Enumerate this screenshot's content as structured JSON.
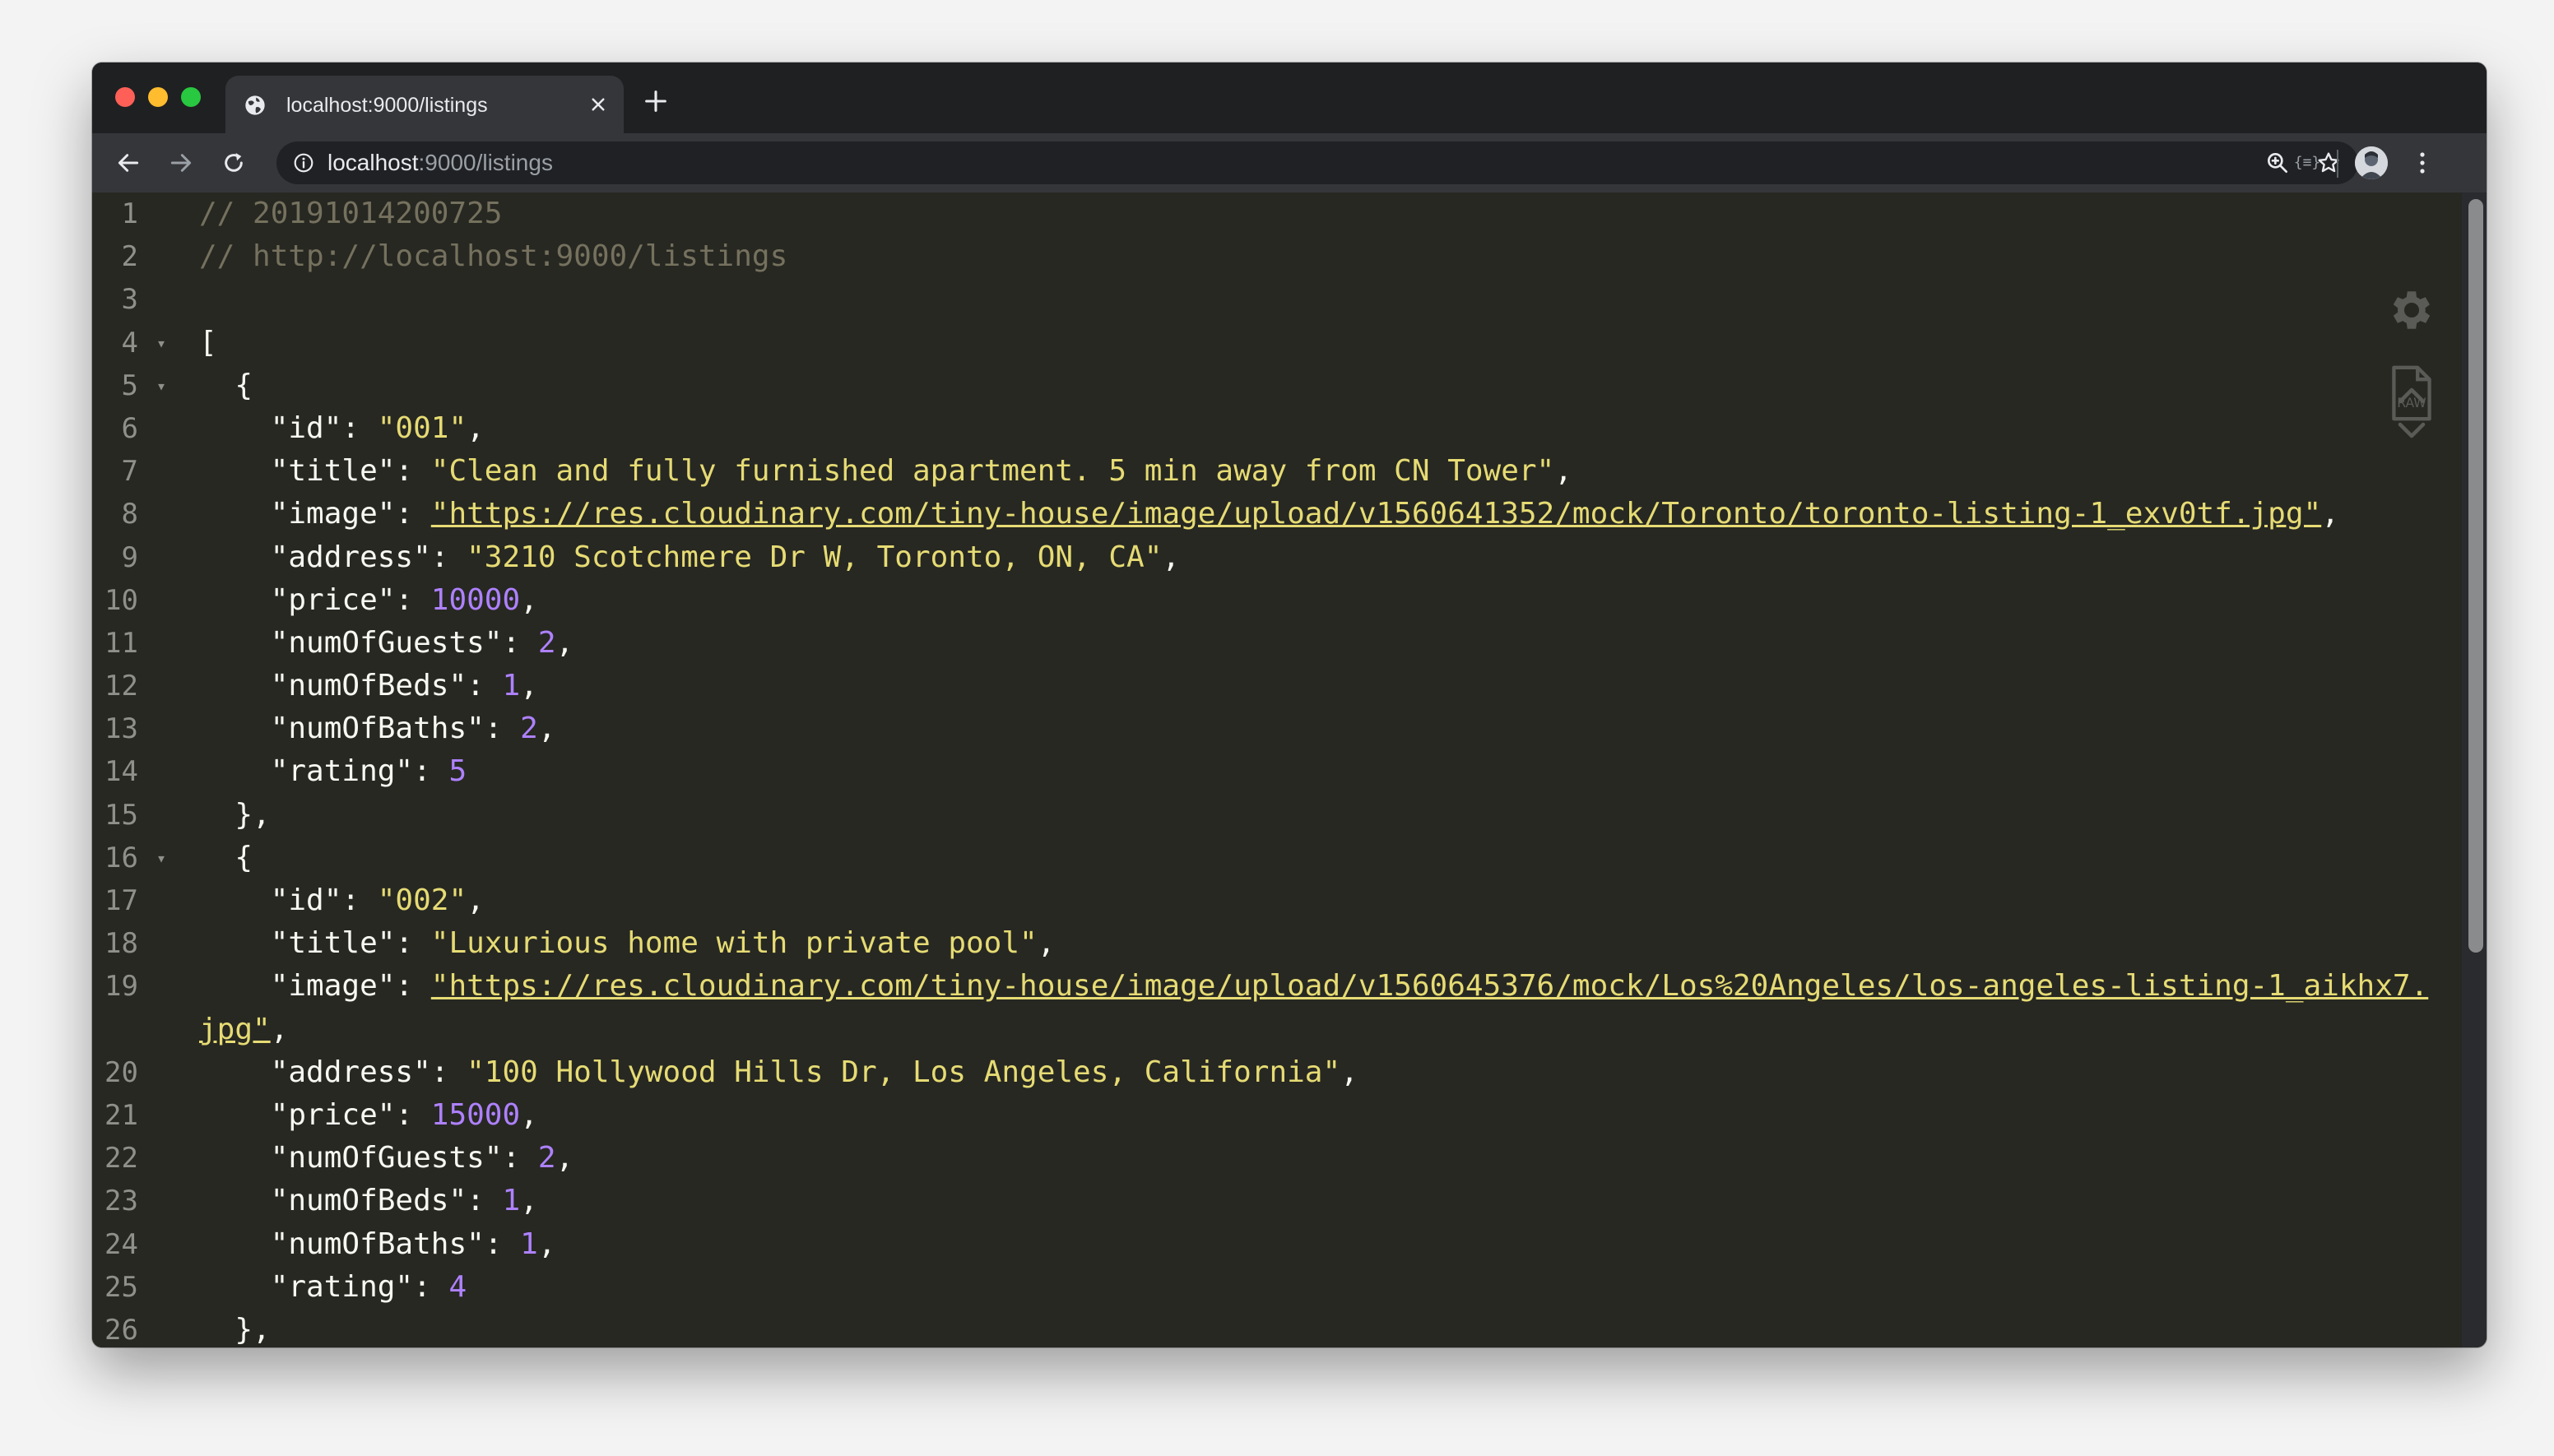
{
  "tab": {
    "title": "localhost:9000/listings"
  },
  "omnibox": {
    "host": "localhost",
    "path": ":9000/listings"
  },
  "extension_label": "{≡}",
  "viewer": {
    "raw_label": "RAW"
  },
  "lines": [
    {
      "n": "1",
      "fold": "",
      "segs": [
        {
          "c": "cm",
          "t": "// 20191014200725"
        }
      ]
    },
    {
      "n": "2",
      "fold": "",
      "segs": [
        {
          "c": "cm",
          "t": "// http://localhost:9000/listings"
        }
      ]
    },
    {
      "n": "3",
      "fold": "",
      "segs": []
    },
    {
      "n": "4",
      "fold": "▾",
      "segs": [
        {
          "c": "key",
          "t": "["
        }
      ]
    },
    {
      "n": "5",
      "fold": "▾",
      "segs": [
        {
          "c": "key",
          "t": "  {"
        }
      ]
    },
    {
      "n": "6",
      "fold": "",
      "segs": [
        {
          "c": "key",
          "t": "    \"id\": "
        },
        {
          "c": "str",
          "t": "\"001\""
        },
        {
          "c": "key",
          "t": ","
        }
      ]
    },
    {
      "n": "7",
      "fold": "",
      "segs": [
        {
          "c": "key",
          "t": "    \"title\": "
        },
        {
          "c": "str",
          "t": "\"Clean and fully furnished apartment. 5 min away from CN Tower\""
        },
        {
          "c": "key",
          "t": ","
        }
      ]
    },
    {
      "n": "8",
      "fold": "",
      "segs": [
        {
          "c": "key",
          "t": "    \"image\": "
        },
        {
          "c": "url",
          "t": "\"https://res.cloudinary.com/tiny-house/image/upload/v1560641352/mock/Toronto/toronto-listing-1_exv0tf.jpg\""
        },
        {
          "c": "key",
          "t": ","
        }
      ]
    },
    {
      "n": "9",
      "fold": "",
      "segs": [
        {
          "c": "key",
          "t": "    \"address\": "
        },
        {
          "c": "str",
          "t": "\"3210 Scotchmere Dr W, Toronto, ON, CA\""
        },
        {
          "c": "key",
          "t": ","
        }
      ]
    },
    {
      "n": "10",
      "fold": "",
      "segs": [
        {
          "c": "key",
          "t": "    \"price\": "
        },
        {
          "c": "num",
          "t": "10000"
        },
        {
          "c": "key",
          "t": ","
        }
      ]
    },
    {
      "n": "11",
      "fold": "",
      "segs": [
        {
          "c": "key",
          "t": "    \"numOfGuests\": "
        },
        {
          "c": "num",
          "t": "2"
        },
        {
          "c": "key",
          "t": ","
        }
      ]
    },
    {
      "n": "12",
      "fold": "",
      "segs": [
        {
          "c": "key",
          "t": "    \"numOfBeds\": "
        },
        {
          "c": "num",
          "t": "1"
        },
        {
          "c": "key",
          "t": ","
        }
      ]
    },
    {
      "n": "13",
      "fold": "",
      "segs": [
        {
          "c": "key",
          "t": "    \"numOfBaths\": "
        },
        {
          "c": "num",
          "t": "2"
        },
        {
          "c": "key",
          "t": ","
        }
      ]
    },
    {
      "n": "14",
      "fold": "",
      "segs": [
        {
          "c": "key",
          "t": "    \"rating\": "
        },
        {
          "c": "num",
          "t": "5"
        }
      ]
    },
    {
      "n": "15",
      "fold": "",
      "segs": [
        {
          "c": "key",
          "t": "  },"
        }
      ]
    },
    {
      "n": "16",
      "fold": "▾",
      "segs": [
        {
          "c": "key",
          "t": "  {"
        }
      ]
    },
    {
      "n": "17",
      "fold": "",
      "segs": [
        {
          "c": "key",
          "t": "    \"id\": "
        },
        {
          "c": "str",
          "t": "\"002\""
        },
        {
          "c": "key",
          "t": ","
        }
      ]
    },
    {
      "n": "18",
      "fold": "",
      "segs": [
        {
          "c": "key",
          "t": "    \"title\": "
        },
        {
          "c": "str",
          "t": "\"Luxurious home with private pool\""
        },
        {
          "c": "key",
          "t": ","
        }
      ]
    },
    {
      "n": "19",
      "fold": "",
      "tall": true,
      "segs": [
        {
          "c": "key",
          "t": "    \"image\": "
        },
        {
          "c": "url",
          "t": "\"https://res.cloudinary.com/tiny-house/image/upload/v1560645376/mock/Los%20Angeles/los-angeles-listing-1_aikhx7.jpg\""
        },
        {
          "c": "key",
          "t": ","
        }
      ]
    },
    {
      "n": "20",
      "fold": "",
      "segs": [
        {
          "c": "key",
          "t": "    \"address\": "
        },
        {
          "c": "str",
          "t": "\"100 Hollywood Hills Dr, Los Angeles, California\""
        },
        {
          "c": "key",
          "t": ","
        }
      ]
    },
    {
      "n": "21",
      "fold": "",
      "segs": [
        {
          "c": "key",
          "t": "    \"price\": "
        },
        {
          "c": "num",
          "t": "15000"
        },
        {
          "c": "key",
          "t": ","
        }
      ]
    },
    {
      "n": "22",
      "fold": "",
      "segs": [
        {
          "c": "key",
          "t": "    \"numOfGuests\": "
        },
        {
          "c": "num",
          "t": "2"
        },
        {
          "c": "key",
          "t": ","
        }
      ]
    },
    {
      "n": "23",
      "fold": "",
      "segs": [
        {
          "c": "key",
          "t": "    \"numOfBeds\": "
        },
        {
          "c": "num",
          "t": "1"
        },
        {
          "c": "key",
          "t": ","
        }
      ]
    },
    {
      "n": "24",
      "fold": "",
      "segs": [
        {
          "c": "key",
          "t": "    \"numOfBaths\": "
        },
        {
          "c": "num",
          "t": "1"
        },
        {
          "c": "key",
          "t": ","
        }
      ]
    },
    {
      "n": "25",
      "fold": "",
      "segs": [
        {
          "c": "key",
          "t": "    \"rating\": "
        },
        {
          "c": "num",
          "t": "4"
        }
      ]
    },
    {
      "n": "26",
      "fold": "",
      "segs": [
        {
          "c": "key",
          "t": "  },"
        }
      ]
    }
  ],
  "colors": {
    "background": "#272822",
    "comment": "#75715e",
    "string": "#e6db74",
    "number": "#ae81ff",
    "text": "#f8f8f2"
  }
}
